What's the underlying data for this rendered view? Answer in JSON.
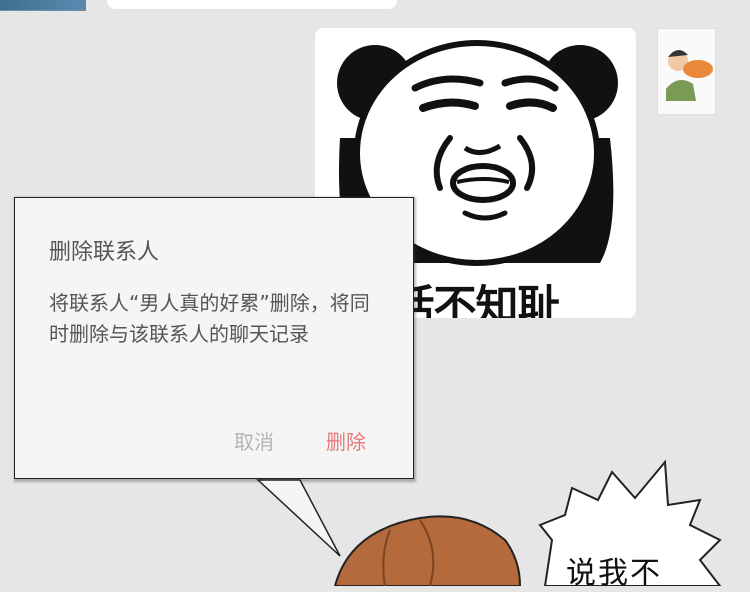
{
  "sticker": {
    "caption": "恬不知耻",
    "icon": "panda-face-meme"
  },
  "avatar": {
    "icon": "person-eating-avatar"
  },
  "dialog": {
    "title": "删除联系人",
    "message": "将联系人“男人真的好累”删除，将同时删除与该联系人的聊天记录",
    "cancel_label": "取消",
    "delete_label": "删除",
    "delete_color": "#e77a7a",
    "cancel_color": "#b4b4b4"
  },
  "speech": {
    "text": "说我不"
  }
}
